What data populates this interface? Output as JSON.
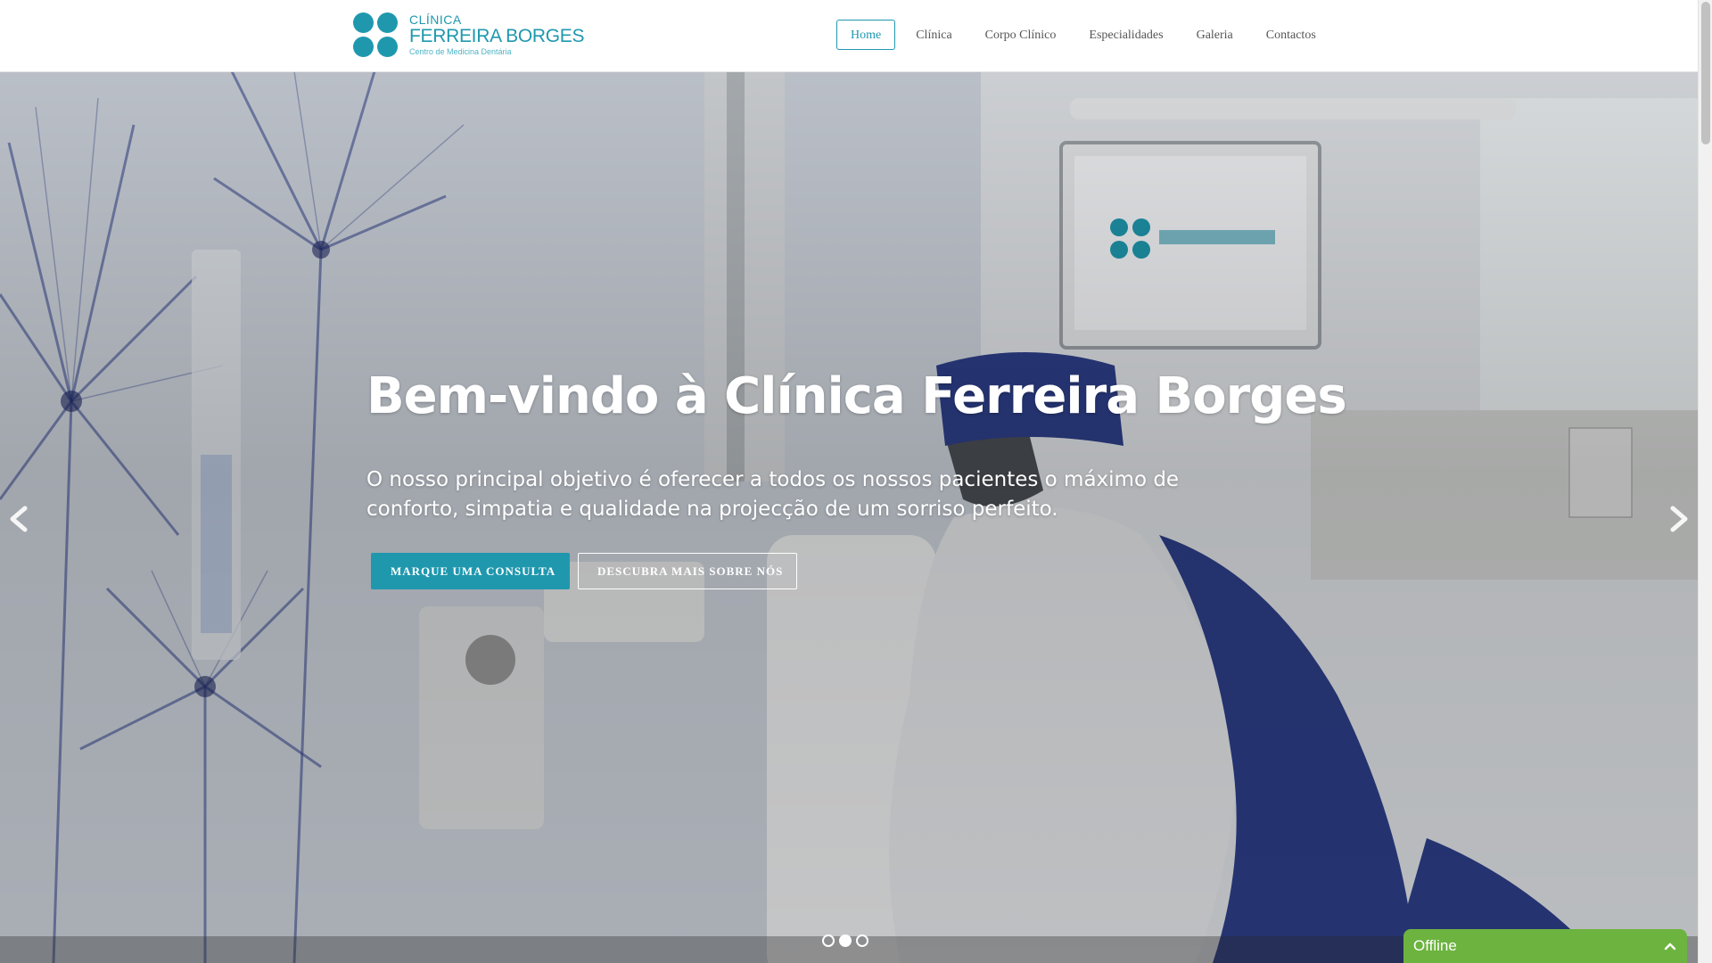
{
  "logo": {
    "line1": "CLÍNICA",
    "line2": "FERREIRA BORGES",
    "line3": "Centro de Medicina Dentária"
  },
  "nav": {
    "items": [
      {
        "label": "Home",
        "active": true
      },
      {
        "label": "Clínica",
        "active": false
      },
      {
        "label": "Corpo Clínico",
        "active": false
      },
      {
        "label": "Especialidades",
        "active": false
      },
      {
        "label": "Galeria",
        "active": false
      },
      {
        "label": "Contactos",
        "active": false
      }
    ]
  },
  "hero": {
    "title": "Bem-vindo à Clínica Ferreira Borges",
    "subtitle": "O nosso principal objetivo é oferecer a todos os nossos pacientes o máximo de conforto, simpatia e qualidade na projecção de um sorriso perfeito.",
    "primary_button": "MARQUE UMA CONSULTA",
    "secondary_button": "DESCUBRA MAIS SOBRE NÓS",
    "prev_icon": "chevron-left-icon",
    "next_icon": "chevron-right-icon",
    "slides_count": 3,
    "active_slide": 2
  },
  "chat": {
    "status": "Offline",
    "icon": "chevron-up-icon"
  },
  "colors": {
    "brand": "#1f98ae",
    "chat": "#6cb33f",
    "nav_text": "#555555"
  }
}
